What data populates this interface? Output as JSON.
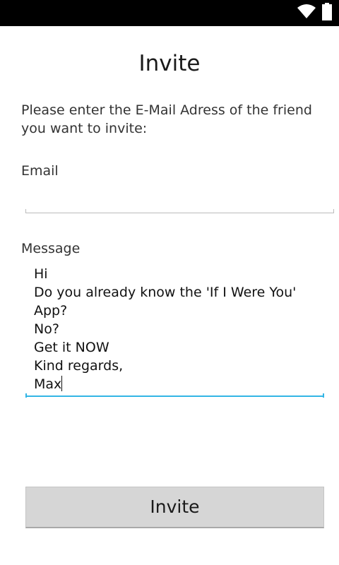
{
  "status_bar": {
    "wifi_icon": "wifi-icon",
    "battery_icon": "battery-icon",
    "background_color": "#000000"
  },
  "title": "Invite",
  "instruction": "Please enter the E-Mail Adress of the friend you want to invite:",
  "email": {
    "label": "Email",
    "value": "",
    "placeholder": ""
  },
  "message": {
    "label": "Message",
    "lines": [
      "Hi",
      "Do you already know the 'If I Were You'",
      "App?",
      "No?",
      "Get it NOW",
      "Kind regards,",
      "Max"
    ],
    "focused": true,
    "focus_color": "#33b5e5"
  },
  "invite_button": {
    "label": "Invite"
  }
}
